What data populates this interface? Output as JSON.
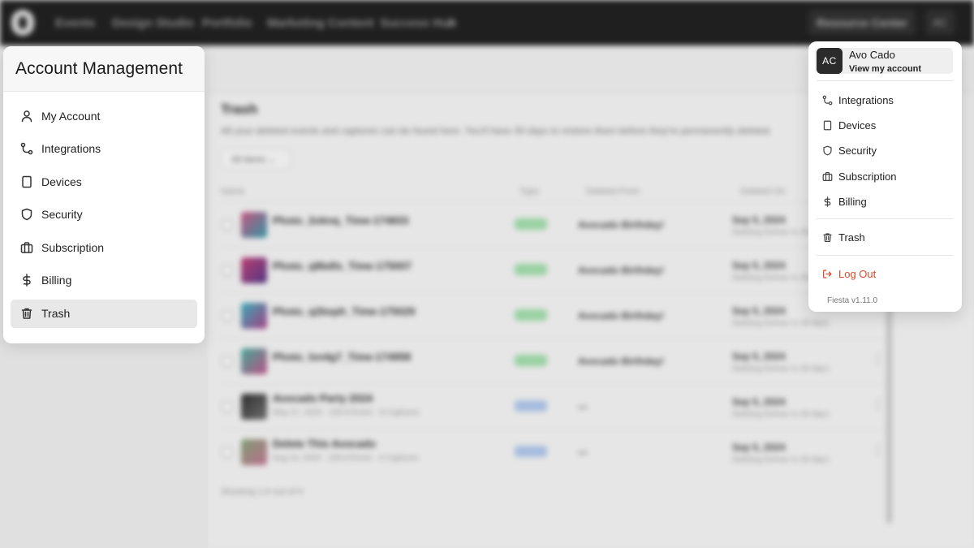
{
  "topnav": {
    "items": [
      "Events",
      "Design Studio",
      "Portfolio",
      "Marketing Content",
      "Success Hub"
    ],
    "resource_center": "Resource Center",
    "avatar_initials": "AC"
  },
  "trash_page": {
    "title": "Trash",
    "description": "All your deleted events and captures can be found here. You'll have 30 days to restore them before they're permanently deleted.",
    "filter": "All Items",
    "columns": [
      "Name",
      "Type",
      "Deleted From",
      "Deleted On"
    ],
    "rows": [
      {
        "name": "Photo_2oknq_Time-174833",
        "meta": "",
        "type": "Capture",
        "from": "Avocado Birthday!",
        "date": "Sep 5, 2024",
        "sub": "Deleting forever in 28 days"
      },
      {
        "name": "Photo_q8bdls_Time-175007",
        "meta": "",
        "type": "Capture",
        "from": "Avocado Birthday!",
        "date": "Sep 5, 2024",
        "sub": "Deleting forever in 28 days"
      },
      {
        "name": "Photo_q2bsph_Time-175029",
        "meta": "",
        "type": "Capture",
        "from": "Avocado Birthday!",
        "date": "Sep 5, 2024",
        "sub": "Deleting forever in 28 days"
      },
      {
        "name": "Photo_lsn4g7_Time-174958",
        "meta": "",
        "type": "Capture",
        "from": "Avocado Birthday!",
        "date": "Sep 5, 2024",
        "sub": "Deleting forever in 28 days"
      },
      {
        "name": "Avocado Party 2024",
        "meta": "May 27, 2024 · 226.8 Event · 8 Captures",
        "type": "Event",
        "from": "—",
        "date": "Sep 5, 2024",
        "sub": "Deleting forever in 28 days"
      },
      {
        "name": "Delete This Avocado",
        "meta": "Aug 13, 2024 · 226.8 Event · 4 Captures",
        "type": "Event",
        "from": "—",
        "date": "Sep 5, 2024",
        "sub": "Deleting forever in 28 days"
      }
    ],
    "footer": "Showing 1-6 out of 6"
  },
  "account_panel": {
    "title": "Account Management",
    "items": [
      {
        "label": "My Account",
        "icon": "user-icon"
      },
      {
        "label": "Integrations",
        "icon": "integrations-icon"
      },
      {
        "label": "Devices",
        "icon": "tablet-icon"
      },
      {
        "label": "Security",
        "icon": "shield-icon"
      },
      {
        "label": "Subscription",
        "icon": "briefcase-icon"
      },
      {
        "label": "Billing",
        "icon": "dollar-icon"
      },
      {
        "label": "Trash",
        "icon": "trash-icon"
      }
    ],
    "active": "Trash"
  },
  "user_menu": {
    "initials": "AC",
    "name": "Avo Cado",
    "view_account": "View my account",
    "items": [
      {
        "label": "Integrations",
        "icon": "integrations-icon"
      },
      {
        "label": "Devices",
        "icon": "tablet-icon"
      },
      {
        "label": "Security",
        "icon": "shield-icon"
      },
      {
        "label": "Subscription",
        "icon": "briefcase-icon"
      },
      {
        "label": "Billing",
        "icon": "dollar-icon"
      }
    ],
    "trash": "Trash",
    "logout": "Log Out",
    "version": "Fiesta v1.11.0"
  },
  "colors": {
    "topnav_bg": "#222222",
    "active_item_bg": "#e8e8e8",
    "logout": "#d84a2e",
    "capture_pill": "#7fd68a",
    "event_pill": "#8fb4ec"
  }
}
